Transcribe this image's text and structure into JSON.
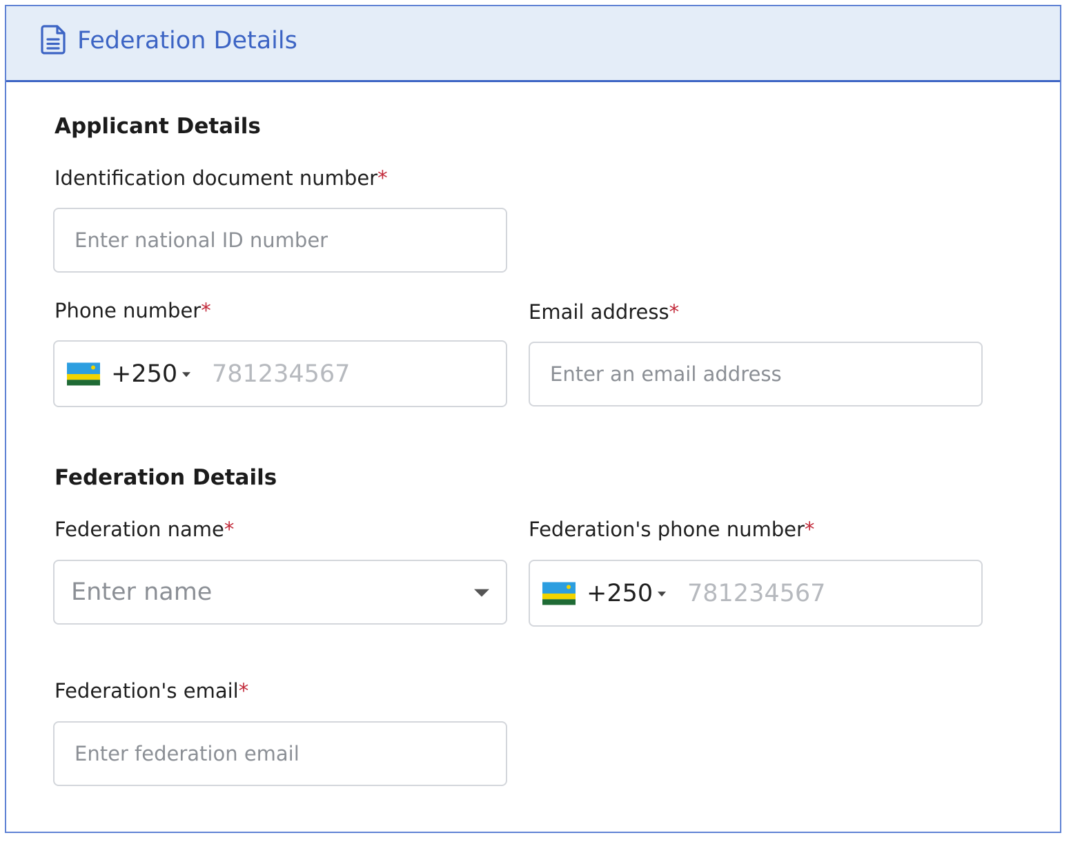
{
  "header": {
    "icon": "document-icon",
    "title": "Federation Details",
    "color": "#3c64c4",
    "background": "#e4edf8"
  },
  "applicant": {
    "section_title": "Applicant Details",
    "id_number": {
      "label": "Identification document number",
      "required_mark": "*",
      "placeholder": "Enter national ID number"
    },
    "phone": {
      "label": "Phone number",
      "required_mark": "*",
      "flag_icon": "rwanda-flag-icon",
      "dial_code": "+250",
      "placeholder": "781234567"
    },
    "email": {
      "label": "Email address",
      "required_mark": "*",
      "placeholder": "Enter an email address"
    }
  },
  "federation": {
    "section_title": "Federation Details",
    "name": {
      "label": "Federation name",
      "required_mark": "*",
      "placeholder": "Enter name"
    },
    "phone": {
      "label": "Federation's phone number",
      "required_mark": "*",
      "flag_icon": "rwanda-flag-icon",
      "dial_code": "+250",
      "placeholder": "781234567"
    },
    "email": {
      "label": "Federation's email",
      "required_mark": "*",
      "placeholder": "Enter federation email"
    }
  },
  "colors": {
    "required": "#c22a3a",
    "border": "#d3d6db",
    "frame": "#5f82d4"
  }
}
